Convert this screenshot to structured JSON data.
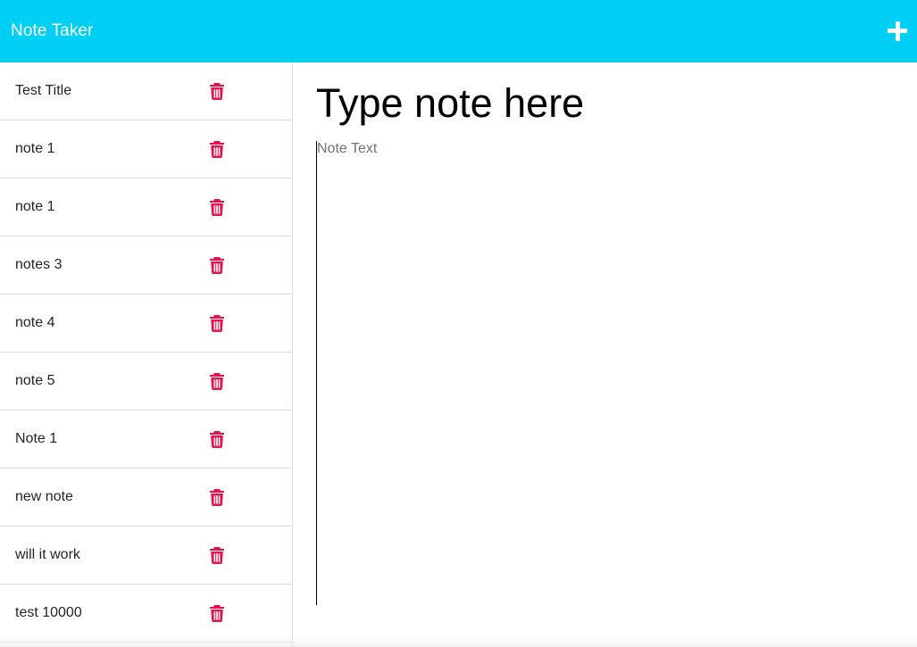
{
  "header": {
    "brand": "Note Taker",
    "add_icon": "plus-icon"
  },
  "sidebar": {
    "delete_icon": "trash-icon",
    "delete_color": "#e8114b",
    "items": [
      {
        "label": "Test Title"
      },
      {
        "label": "note 1"
      },
      {
        "label": "note 1"
      },
      {
        "label": "notes 3"
      },
      {
        "label": "note 4"
      },
      {
        "label": "note 5"
      },
      {
        "label": "Note 1"
      },
      {
        "label": "new note"
      },
      {
        "label": "will it work"
      },
      {
        "label": "test 10000"
      }
    ]
  },
  "editor": {
    "title_placeholder": "Type note here",
    "text_placeholder": "Note Text"
  },
  "colors": {
    "navbar": "#00cff5",
    "accent_delete": "#e8114b"
  }
}
